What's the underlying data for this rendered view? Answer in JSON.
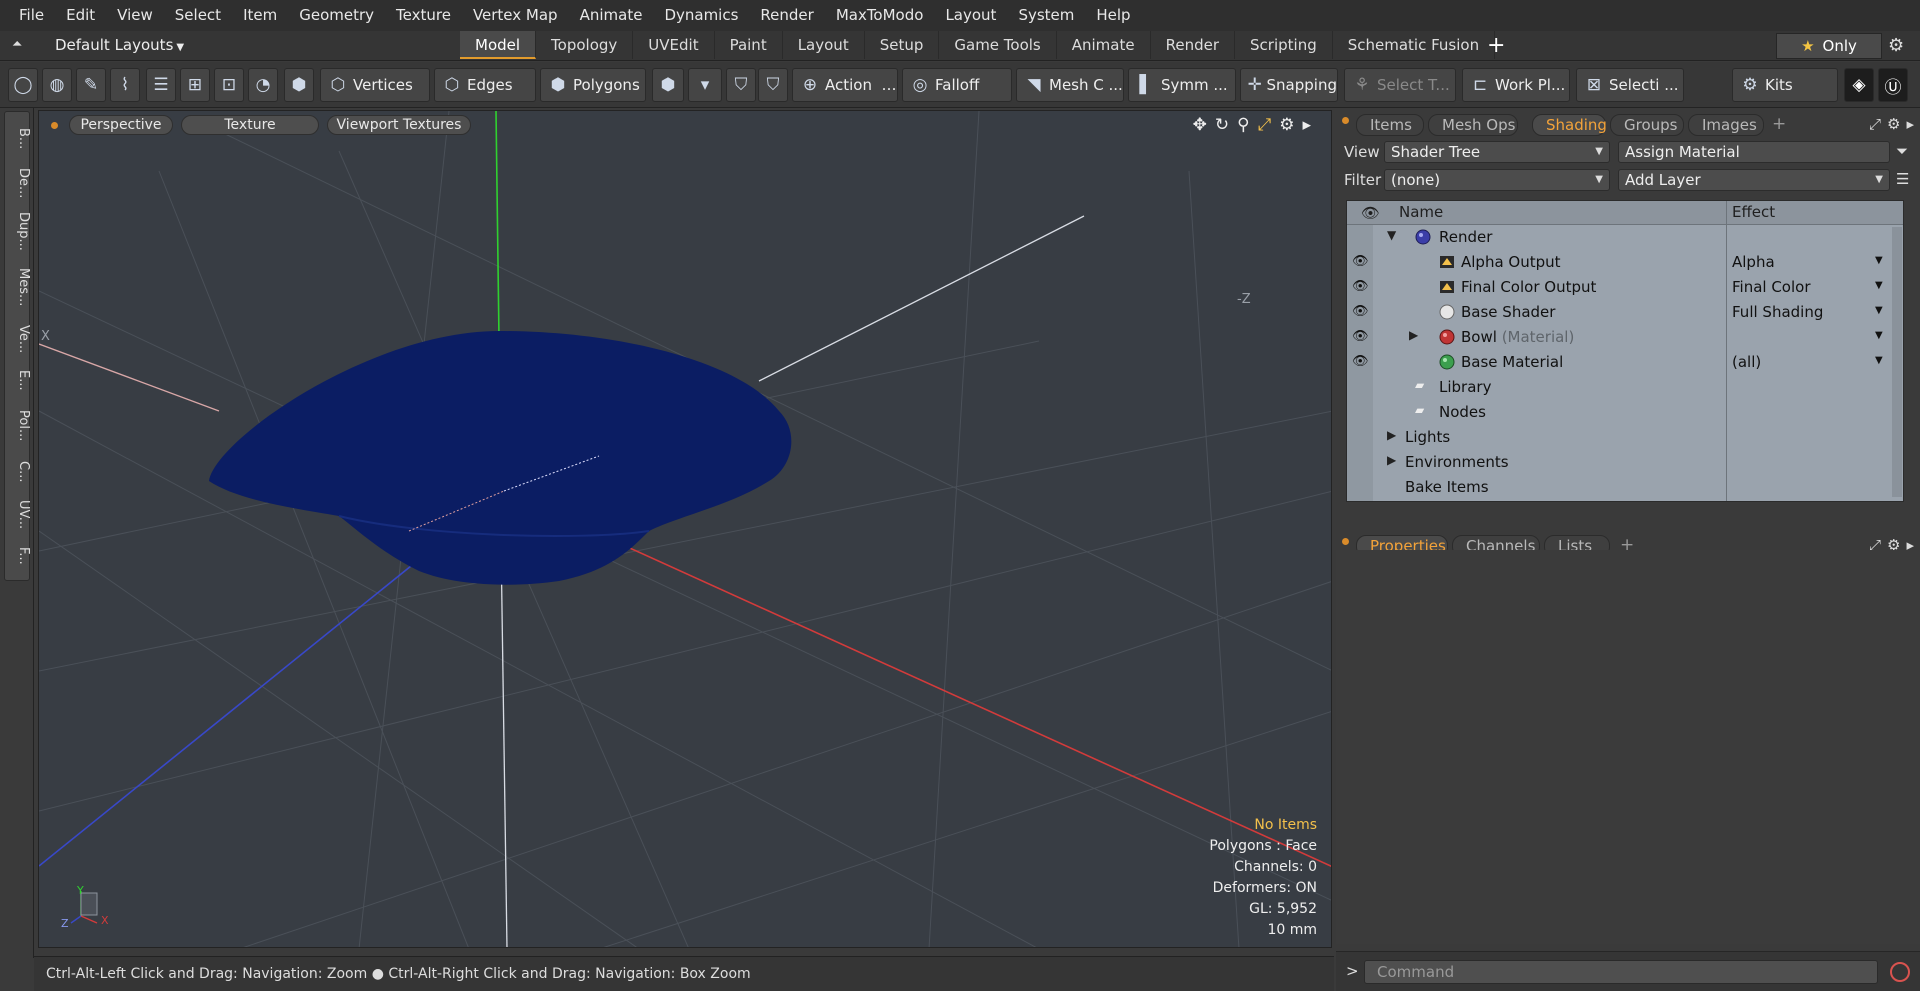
{
  "menu": [
    "File",
    "Edit",
    "View",
    "Select",
    "Item",
    "Geometry",
    "Texture",
    "Vertex Map",
    "Animate",
    "Dynamics",
    "Render",
    "MaxToModo",
    "Layout",
    "System",
    "Help"
  ],
  "layout_bar": {
    "layout_select": "Default Layouts",
    "tabs": [
      "Model",
      "Topology",
      "UVEdit",
      "Paint",
      "Layout",
      "Setup",
      "Game Tools",
      "Animate",
      "Render",
      "Scripting",
      "Schematic Fusion"
    ],
    "active_tab": "Model",
    "only_label": "Only"
  },
  "toolbar": {
    "vertices": "Vertices",
    "edges": "Edges",
    "polygons": "Polygons",
    "action": "Action",
    "falloff": "Falloff",
    "mesh_c": "Mesh C ...",
    "symm": "Symm ...",
    "snapping": "Snapping",
    "select_t": "Select T...",
    "work_pl": "Work Pl...",
    "selecti": "Selecti ...",
    "kits": "Kits"
  },
  "left_tabs": [
    "B...",
    "De...",
    "Dup...",
    "Mes...",
    "Ve...",
    "E...",
    "Pol...",
    "C...",
    "UV...",
    "F..."
  ],
  "viewport": {
    "buttons": [
      "Perspective",
      "Texture",
      "Viewport Textures"
    ],
    "axis_label_x": "X",
    "axis_label_z": "-Z",
    "stats": {
      "items": "No Items",
      "polygons": "Polygons : Face",
      "channels": "Channels: 0",
      "deformers": "Deformers: ON",
      "gl": "GL: 5,952",
      "scale": "10 mm"
    },
    "gizmo": {
      "y": "Y",
      "x": "X",
      "z": "Z"
    },
    "mesh_color": "#0b1d63"
  },
  "status_bar": {
    "hint1": "Ctrl-Alt-Left Click and Drag: Navigation: Zoom",
    "hint2": "Ctrl-Alt-Right Click and Drag: Navigation: Box Zoom"
  },
  "right_panel": {
    "top_tabs": [
      "Items",
      "Mesh Ops",
      "Shading",
      "Groups",
      "Images"
    ],
    "active_top_tab": "Shading",
    "view_label": "View",
    "view_value": "Shader Tree",
    "assign_material": "Assign Material",
    "filter_label": "Filter",
    "filter_value": "(none)",
    "add_layer": "Add Layer",
    "shader_tree": {
      "col_name": "Name",
      "col_effect": "Effect",
      "rows": [
        {
          "name": "Render",
          "effect": ""
        },
        {
          "name": "Alpha Output",
          "effect": "Alpha"
        },
        {
          "name": "Final Color Output",
          "effect": "Final Color"
        },
        {
          "name": "Base Shader",
          "effect": "Full Shading"
        },
        {
          "name": "Bowl",
          "sub": "(Material)",
          "effect": ""
        },
        {
          "name": "Base Material",
          "effect": "(all)"
        },
        {
          "name": "Library",
          "effect": ""
        },
        {
          "name": "Nodes",
          "effect": ""
        },
        {
          "name": "Lights",
          "effect": ""
        },
        {
          "name": "Environments",
          "effect": ""
        },
        {
          "name": "Bake Items",
          "effect": ""
        }
      ]
    },
    "bottom_tabs": [
      "Properties",
      "Channels",
      "Lists"
    ],
    "active_bottom_tab": "Properties",
    "command_placeholder": "Command"
  }
}
